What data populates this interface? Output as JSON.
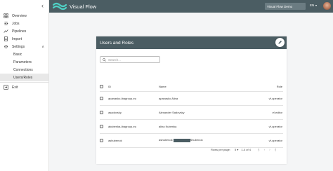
{
  "app": {
    "title": "Visual Flow",
    "project": "Visual Flow Demo",
    "language": "EN"
  },
  "sidebar": {
    "collapse_icon": "chevron-left-icon",
    "items": [
      {
        "label": "Overview",
        "icon": "grid-icon"
      },
      {
        "label": "Jobs",
        "icon": "jobs-icon"
      },
      {
        "label": "Pipelines",
        "icon": "pipelines-icon"
      },
      {
        "label": "Import",
        "icon": "import-icon"
      },
      {
        "label": "Settings",
        "icon": "gear-icon",
        "expanded": true
      }
    ],
    "settings_items": [
      {
        "label": "Basic"
      },
      {
        "label": "Parameters"
      },
      {
        "label": "Connections"
      },
      {
        "label": "Users/Roles",
        "active": true
      }
    ],
    "exit_label": "Exit"
  },
  "card": {
    "title": "Users and Roles",
    "search_placeholder": "Search...",
    "columns": {
      "id": "ID",
      "name": "Name",
      "role": "Role"
    },
    "rows": [
      {
        "id": "apanasko-ibagroup-eu",
        "name": "apanasko Alina",
        "role": "vf-operator"
      },
      {
        "id": "asadovsky",
        "name": "Alexander Sadovsky",
        "role": "vf-editor"
      },
      {
        "id": "akubenka-ibagroup-eu",
        "name": "alina Kubenka",
        "role": "vf-operator"
      },
      {
        "id": "ashubenok",
        "name_prefix": "ashubenok",
        "name_suffix": "Shubenok",
        "role": "vf-operator"
      }
    ],
    "pagination": {
      "rows_label": "Rows per page:",
      "rows_value": "5",
      "range": "1-4 of 4"
    }
  },
  "colors": {
    "primary": "#4b5d63",
    "accent": "#4fd1c5"
  }
}
